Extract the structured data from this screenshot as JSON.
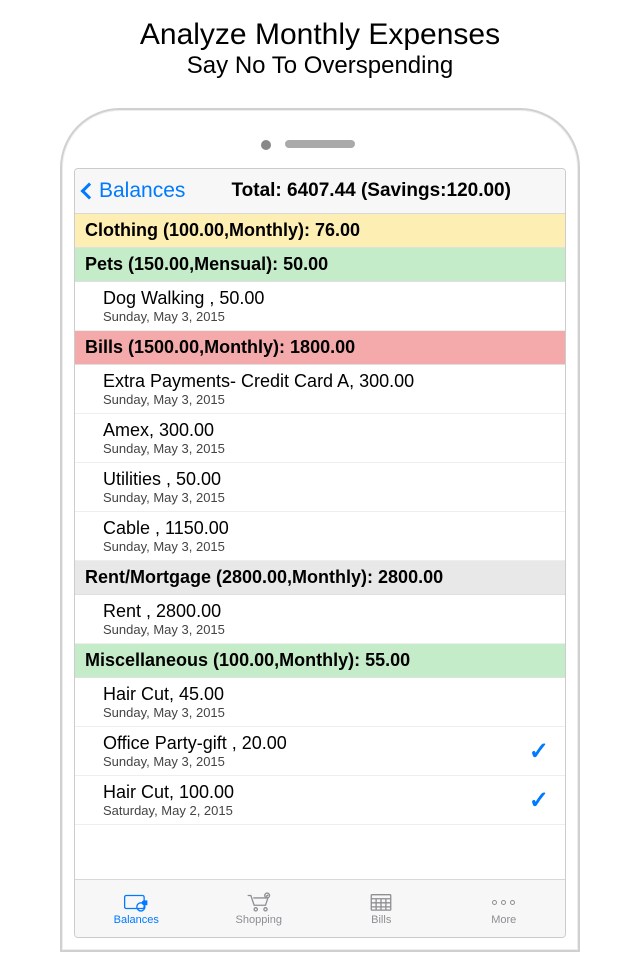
{
  "promo": {
    "title": "Analyze Monthly Expenses",
    "subtitle": "Say No To Overspending"
  },
  "nav": {
    "back_label": "Balances",
    "title": "Total: 6407.44 (Savings:120.00)"
  },
  "sections": [
    {
      "header": "Clothing (100.00,Monthly): 76.00",
      "color": "yellow",
      "items": []
    },
    {
      "header": "Pets (150.00,Mensual): 50.00",
      "color": "green",
      "items": [
        {
          "title": "Dog Walking , 50.00",
          "date": "Sunday, May 3, 2015",
          "checked": false
        }
      ]
    },
    {
      "header": "Bills (1500.00,Monthly): 1800.00",
      "color": "red",
      "items": [
        {
          "title": "Extra Payments- Credit Card A, 300.00",
          "date": "Sunday, May 3, 2015",
          "checked": false
        },
        {
          "title": "Amex, 300.00",
          "date": "Sunday, May 3, 2015",
          "checked": false
        },
        {
          "title": "Utilities , 50.00",
          "date": "Sunday, May 3, 2015",
          "checked": false
        },
        {
          "title": "Cable , 1150.00",
          "date": "Sunday, May 3, 2015",
          "checked": false
        }
      ]
    },
    {
      "header": "Rent/Mortgage (2800.00,Monthly): 2800.00",
      "color": "gray",
      "items": [
        {
          "title": "Rent , 2800.00",
          "date": "Sunday, May 3, 2015",
          "checked": false
        }
      ]
    },
    {
      "header": "Miscellaneous (100.00,Monthly): 55.00",
      "color": "green",
      "items": [
        {
          "title": "Hair Cut, 45.00",
          "date": "Sunday, May 3, 2015",
          "checked": false
        },
        {
          "title": "Office Party-gift , 20.00",
          "date": "Sunday, May 3, 2015",
          "checked": true
        },
        {
          "title": "Hair Cut, 100.00",
          "date": "Saturday, May 2, 2015",
          "checked": true
        }
      ]
    }
  ],
  "tabs": {
    "balances": "Balances",
    "shopping": "Shopping",
    "bills": "Bills",
    "more": "More"
  }
}
